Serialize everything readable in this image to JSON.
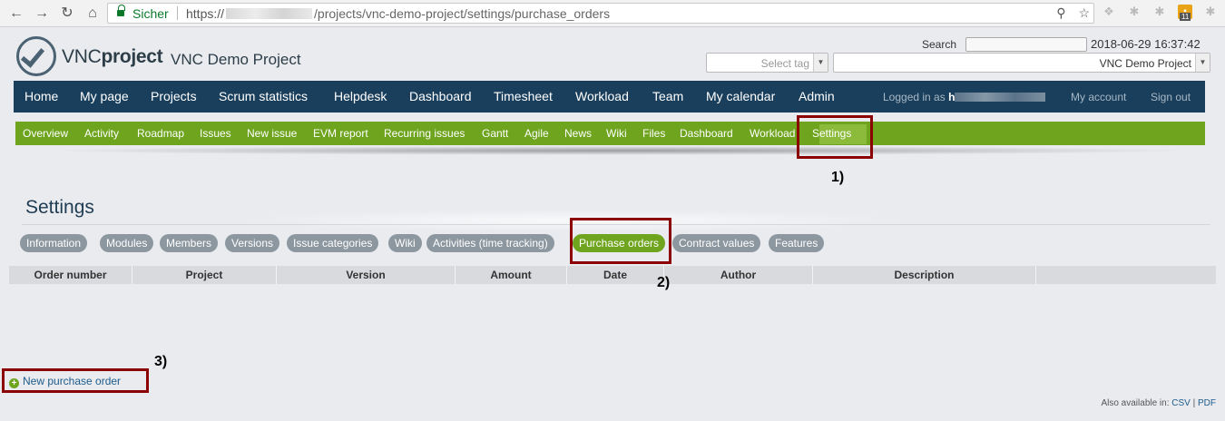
{
  "browser": {
    "secure_label": "Sicher",
    "url_prefix": "https://",
    "url_path": "/projects/vnc-demo-project/settings/purchase_orders",
    "extensions_badge": "11"
  },
  "header": {
    "logo_light": "VNC",
    "logo_bold": "project",
    "project_name": "VNC Demo Project",
    "search_label": "Search",
    "datetime": "2018-06-29 16:37:42",
    "select_tag_placeholder": "Select tag",
    "project_select_value": "VNC Demo Project"
  },
  "topnav": {
    "items": [
      "Home",
      "My page",
      "Projects",
      "Scrum statistics",
      "Helpdesk",
      "Dashboard",
      "Timesheet",
      "Workload",
      "Team",
      "My calendar",
      "Admin"
    ],
    "logged_in_as": "Logged in as",
    "user_initial": "h",
    "my_account": "My account",
    "sign_out": "Sign out"
  },
  "project_menu": {
    "items": [
      "Overview",
      "Activity",
      "Roadmap",
      "Issues",
      "New issue",
      "EVM report",
      "Recurring issues",
      "Gantt",
      "Agile",
      "News",
      "Wiki",
      "Files",
      "Dashboard",
      "Workload",
      "Settings"
    ],
    "active": "Settings"
  },
  "annotations": {
    "one": "1)",
    "two": "2)",
    "three": "3)"
  },
  "settings": {
    "title": "Settings",
    "tabs": [
      "Information",
      "Modules",
      "Members",
      "Versions",
      "Issue categories",
      "Wiki",
      "Activities (time tracking)",
      "Purchase orders",
      "Contract values",
      "Features"
    ],
    "active_tab": "Purchase orders",
    "columns": [
      "Order number",
      "Project",
      "Version",
      "Amount",
      "Date",
      "Author",
      "Description"
    ],
    "new_label": "New purchase order",
    "also_available": "Also available in:",
    "csv": "CSV",
    "pdf": "PDF"
  },
  "colors": {
    "nav_blue": "#1a3f5c",
    "menu_green": "#6ea41e",
    "tab_gray": "#8c97a0",
    "highlight_red": "#8b0000"
  }
}
